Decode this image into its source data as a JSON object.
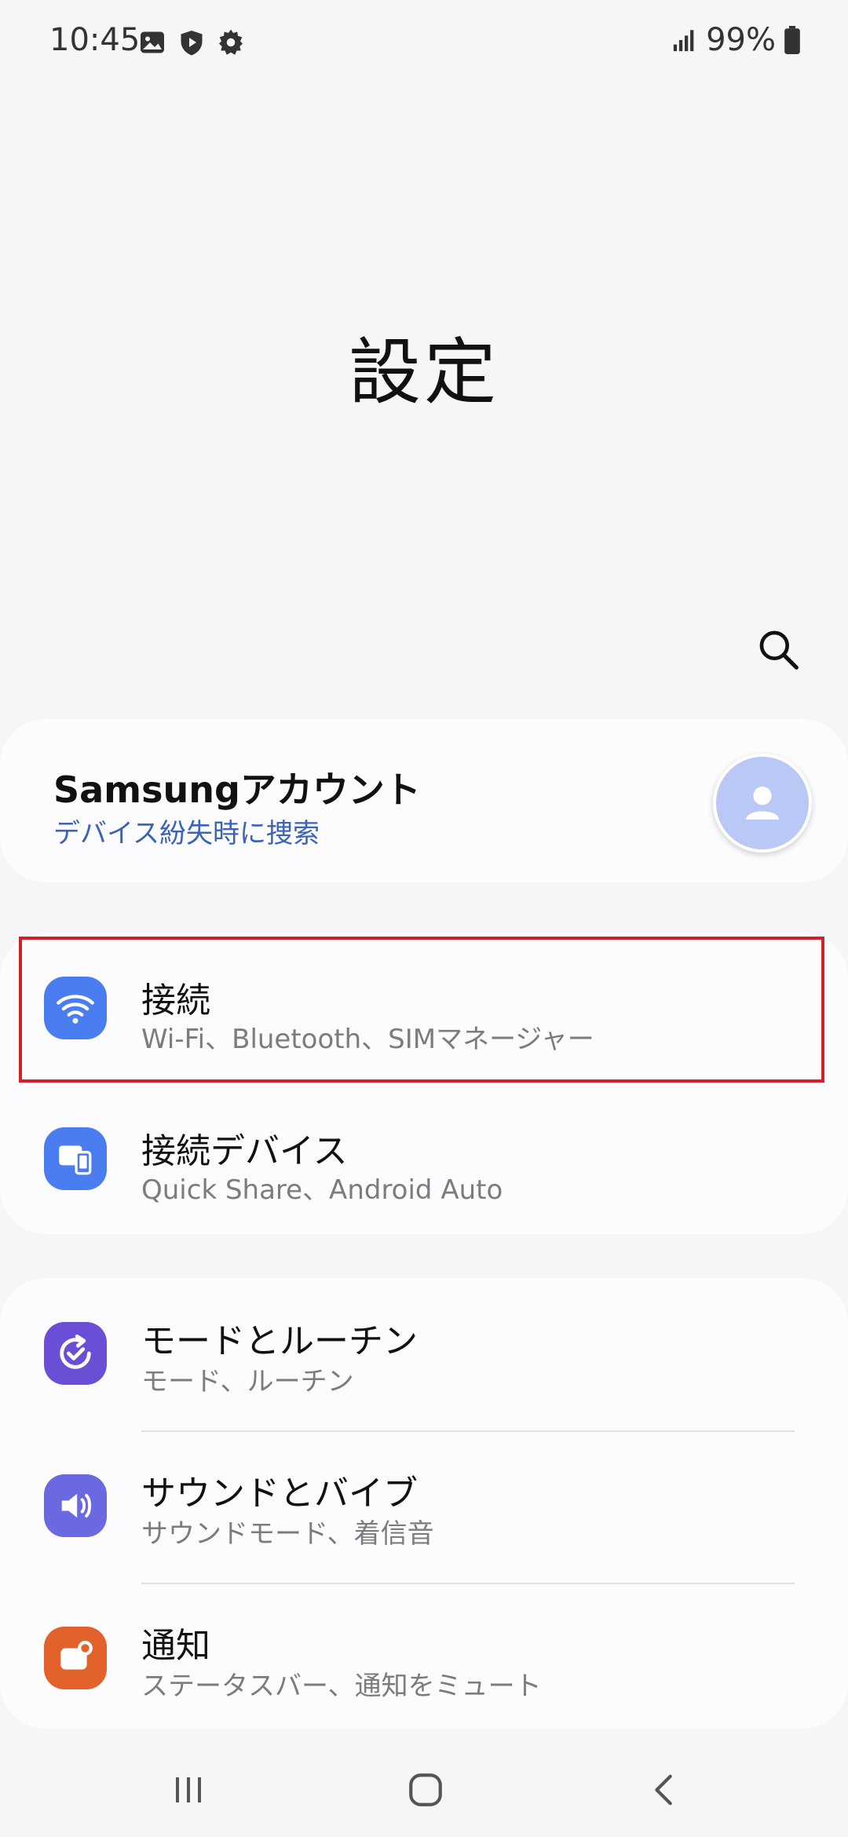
{
  "status_bar": {
    "time": "10:45",
    "battery": "99%",
    "icons": [
      "gallery-icon",
      "shield-play-icon",
      "gear-icon",
      "signal-icon",
      "battery-icon"
    ]
  },
  "header": {
    "title": "設定",
    "search_icon": "search-icon"
  },
  "account": {
    "name": "Samsungアカウント",
    "subtitle": "デバイス紛失時に捜索",
    "avatar_icon": "person-icon"
  },
  "settings_groups": [
    {
      "items": [
        {
          "title": "接続",
          "subtitle": "Wi-Fi、Bluetooth、SIMマネージャー",
          "icon": "wifi-icon",
          "color": "#4a7df0"
        },
        {
          "title": "接続デバイス",
          "subtitle": "Quick Share、Android Auto",
          "icon": "connected-devices-icon",
          "color": "#4a7df0"
        }
      ]
    },
    {
      "items": [
        {
          "title": "モードとルーチン",
          "subtitle": "モード、ルーチン",
          "icon": "modes-routines-icon",
          "color": "#6a4fd6"
        },
        {
          "title": "サウンドとバイブ",
          "subtitle": "サウンドモード、着信音",
          "icon": "sound-icon",
          "color": "#6b69e0"
        },
        {
          "title": "通知",
          "subtitle": "ステータスバー、通知をミュート",
          "icon": "notification-icon",
          "color": "#e3622c"
        }
      ]
    }
  ],
  "highlight_color": "#d0202a",
  "nav_bar": {
    "icons": [
      "recents-icon",
      "home-icon",
      "back-icon"
    ]
  }
}
